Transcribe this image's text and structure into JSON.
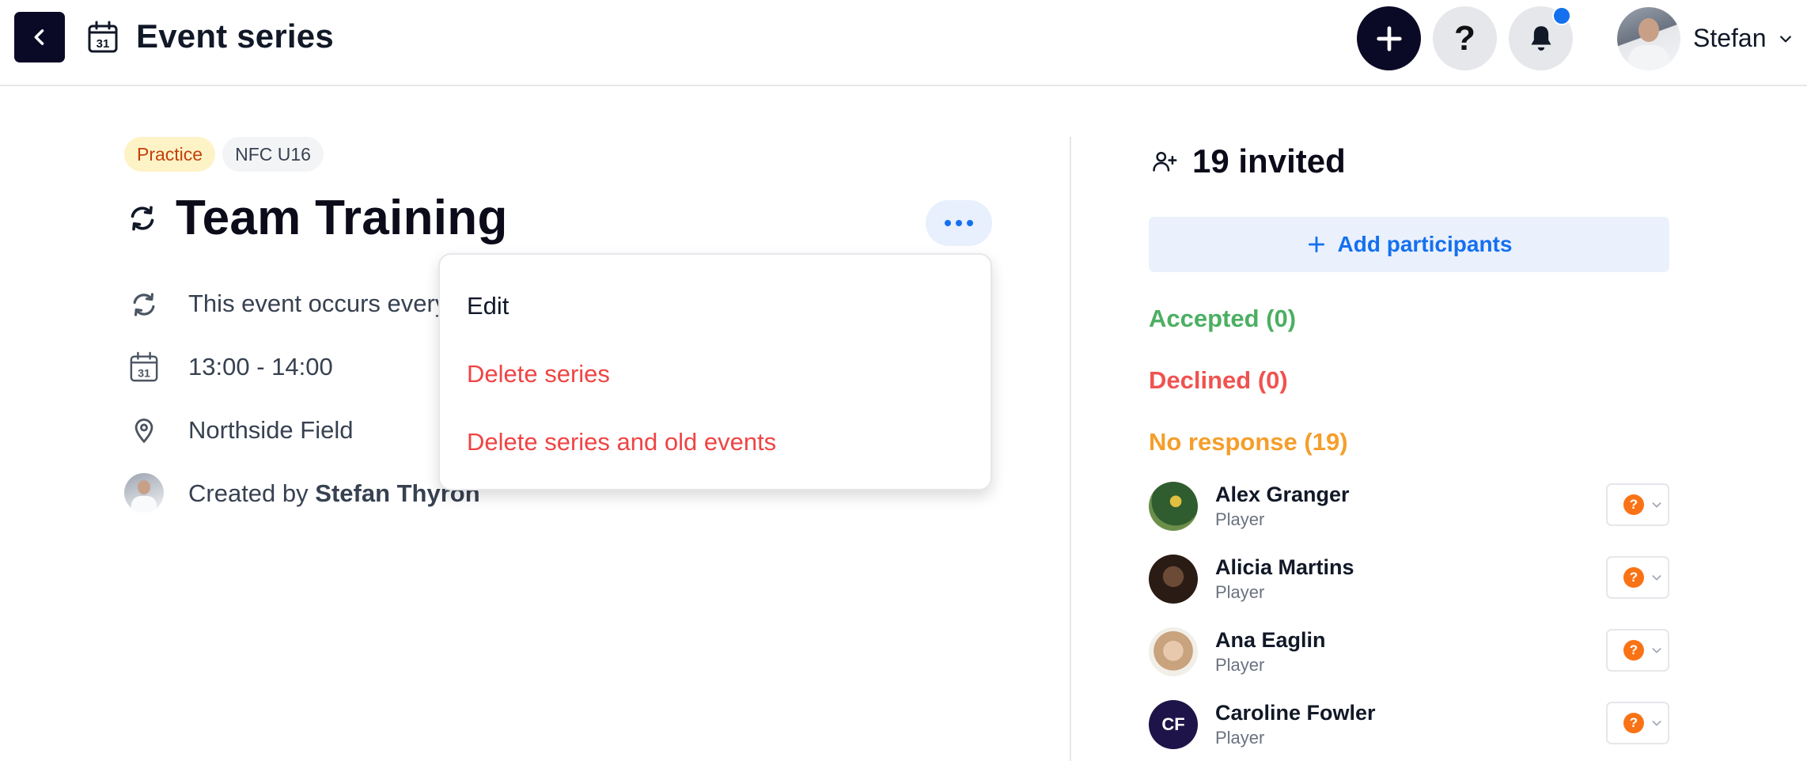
{
  "header": {
    "title": "Event series",
    "calendar_day": "31",
    "help_label": "?",
    "user_name": "Stefan"
  },
  "event": {
    "tags": [
      "Practice",
      "NFC U16"
    ],
    "title": "Team Training",
    "recurrence_text": "This event occurs every",
    "time": "13:00 - 14:00",
    "location": "Northside Field",
    "created_by_prefix": "Created by",
    "created_by_name": "Stefan Thyron"
  },
  "dropdown": {
    "items": [
      "Edit",
      "Delete series",
      "Delete series and old events"
    ]
  },
  "participants": {
    "invited": "19 invited",
    "add_label": "Add participants",
    "groups": {
      "accepted": "Accepted (0)",
      "declined": "Declined (0)",
      "no_response": "No response (19)"
    },
    "list": [
      {
        "name": "Alex Granger",
        "role": "Player",
        "status": "?"
      },
      {
        "name": "Alicia Martins",
        "role": "Player",
        "status": "?"
      },
      {
        "name": "Ana Eaglin",
        "role": "Player",
        "status": "?"
      },
      {
        "name": "Caroline Fowler",
        "role": "Player",
        "status": "?",
        "initials": "CF"
      }
    ]
  },
  "colors": {
    "accent": "#1570ef",
    "dark": "#0b0a26",
    "accepted": "#4caf62",
    "declined": "#ef5350",
    "no_response": "#f59e2b",
    "danger": "#ef4444"
  }
}
